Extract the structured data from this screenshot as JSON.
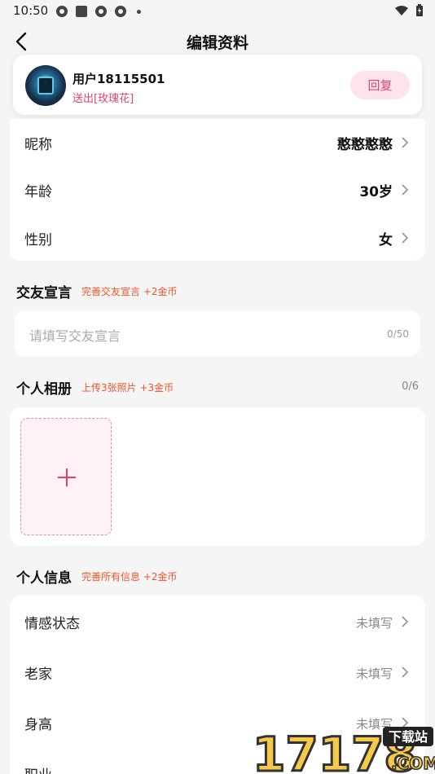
{
  "status_bar": {
    "time": "10:50"
  },
  "header": {
    "title": "编辑资料"
  },
  "user_card": {
    "name": "用户18115501",
    "subtitle": "送出[玫瑰花]",
    "reply_label": "回复"
  },
  "basic_info": [
    {
      "label": "昵称",
      "value": "憨憨憨憨"
    },
    {
      "label": "年龄",
      "value": "30岁"
    },
    {
      "label": "性别",
      "value": "女"
    }
  ],
  "declaration": {
    "title": "交友宣言",
    "hint": "完善交友宣言 +2金币",
    "placeholder": "请填写交友宣言",
    "count": "0/50"
  },
  "album": {
    "title": "个人相册",
    "hint": "上传3张照片 +3金币",
    "count": "0/6"
  },
  "personal_info": {
    "title": "个人信息",
    "hint": "完善所有信息 +2金币",
    "items": [
      {
        "label": "情感状态",
        "value": "未填写"
      },
      {
        "label": "老家",
        "value": "未填写"
      },
      {
        "label": "身高",
        "value": "未填写"
      },
      {
        "label": "职业",
        "value": ""
      }
    ]
  },
  "watermark": {
    "number": "17178",
    "tag": "下载站",
    "domain": ".COM"
  },
  "colors": {
    "accent": "#e83e6f",
    "hint": "#f0552a",
    "background": "#f5f5f5"
  }
}
